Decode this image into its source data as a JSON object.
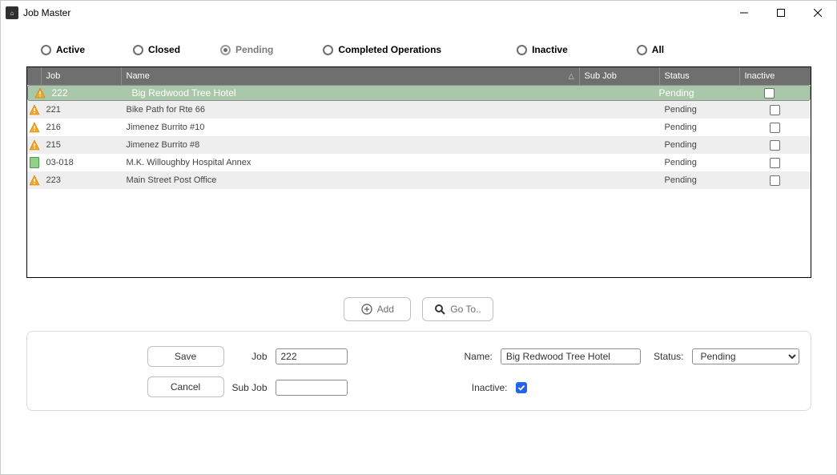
{
  "window": {
    "title": "Job Master"
  },
  "filters": {
    "options": [
      "Active",
      "Closed",
      "Pending",
      "Completed Operations",
      "Inactive",
      "All"
    ],
    "selected_index": 2
  },
  "columns": {
    "job": "Job",
    "name": "Name",
    "subjob": "Sub Job",
    "status": "Status",
    "inactive": "Inactive",
    "sorted_column": "name",
    "sort_direction": "asc"
  },
  "rows": [
    {
      "icon": "warn",
      "job": "222",
      "name": "Big Redwood Tree Hotel",
      "subjob": "",
      "status": "Pending",
      "inactive": false,
      "selected": true
    },
    {
      "icon": "warn",
      "job": "221",
      "name": "Bike Path for Rte 66",
      "subjob": "",
      "status": "Pending",
      "inactive": false,
      "selected": false
    },
    {
      "icon": "warn",
      "job": "216",
      "name": "Jimenez Burrito #10",
      "subjob": "",
      "status": "Pending",
      "inactive": false,
      "selected": false
    },
    {
      "icon": "warn",
      "job": "215",
      "name": "Jimenez Burrito #8",
      "subjob": "",
      "status": "Pending",
      "inactive": false,
      "selected": false
    },
    {
      "icon": "file",
      "job": "03-018",
      "name": "M.K. Willoughby Hospital Annex",
      "subjob": "",
      "status": "Pending",
      "inactive": false,
      "selected": false
    },
    {
      "icon": "warn",
      "job": "223",
      "name": "Main Street Post Office",
      "subjob": "",
      "status": "Pending",
      "inactive": false,
      "selected": false
    }
  ],
  "buttons": {
    "add": "Add",
    "goto": "Go To..",
    "save": "Save",
    "cancel": "Cancel"
  },
  "detail": {
    "labels": {
      "job": "Job",
      "name": "Name:",
      "status": "Status:",
      "subjob": "Sub Job",
      "inactive": "Inactive:"
    },
    "values": {
      "job": "222",
      "name": "Big Redwood Tree Hotel",
      "status": "Pending",
      "subjob": "",
      "inactive": true
    }
  }
}
